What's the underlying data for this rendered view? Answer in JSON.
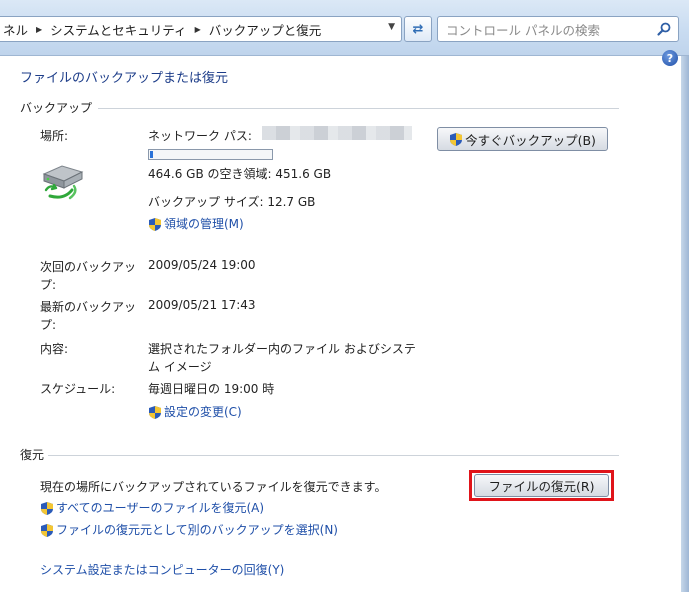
{
  "address_bar": {
    "crumbs": [
      "ネル",
      "システムとセキュリティ",
      "バックアップと復元"
    ],
    "search_placeholder": "コントロール パネルの検索"
  },
  "page": {
    "title": "ファイルのバックアップまたは復元",
    "help": "?"
  },
  "backup": {
    "heading": "バックアップ",
    "location_label": "場所:",
    "location_value": "ネットワーク パス:",
    "space_text": "464.6 GB の空き領域: 451.6 GB",
    "used_fraction": 0.028,
    "size_text": "バックアップ サイズ: 12.7 GB",
    "manage_space_link": "領域の管理(M)",
    "backup_now_button": "今すぐバックアップ(B)",
    "next_backup_label_1": "次回のバックアッ",
    "next_backup_label_2": "プ:",
    "next_backup_value": "2009/05/24 19:00",
    "last_backup_label_1": "最新のバックアッ",
    "last_backup_label_2": "プ:",
    "last_backup_value": "2009/05/21 17:43",
    "contents_label": "内容:",
    "contents_value_1": "選択されたフォルダー内のファイル およびシステ",
    "contents_value_2": "ム イメージ",
    "schedule_label": "スケジュール:",
    "schedule_value": "毎週日曜日の 19:00 時",
    "change_settings_link": "設定の変更(C)"
  },
  "restore": {
    "heading": "復元",
    "description": "現在の場所にバックアップされているファイルを復元できます。",
    "restore_files_button": "ファイルの復元(R)",
    "restore_all_users_link": "すべてのユーザーのファイルを復元(A)",
    "select_other_backup_link": "ファイルの復元元として別のバックアップを選択(N)",
    "recover_system_link": "システム設定またはコンピューターの回復(Y)"
  },
  "colors": {
    "link": "#1f4fa8",
    "highlight": "#e0141a",
    "progress_fill": "#2a72d8"
  }
}
